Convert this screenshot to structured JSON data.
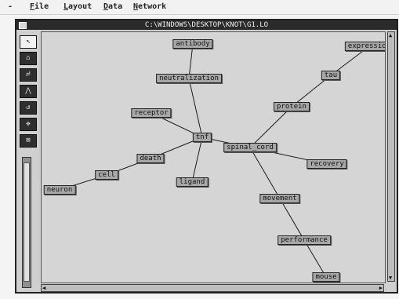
{
  "menubar": {
    "system_menu": "-",
    "items": [
      {
        "underline": "F",
        "rest": "ile"
      },
      {
        "underline": "L",
        "rest": "ayout"
      },
      {
        "underline": "D",
        "rest": "ata"
      },
      {
        "underline": "N",
        "rest": "etwork"
      }
    ]
  },
  "window": {
    "title": "C:\\WINDOWS\\DESKTOP\\KNOT\\G1.LO"
  },
  "toolbar": {
    "tools": [
      {
        "name": "select-tool",
        "glyph": "↖"
      },
      {
        "name": "node-tool",
        "glyph": "⌂"
      },
      {
        "name": "link-tool",
        "glyph": "≓"
      },
      {
        "name": "line-tool",
        "glyph": "⋀"
      },
      {
        "name": "rotate-tool",
        "glyph": "↺"
      },
      {
        "name": "move-tool",
        "glyph": "✥"
      },
      {
        "name": "layout-tool",
        "glyph": "⊠"
      }
    ]
  },
  "graph": {
    "nodes": [
      {
        "id": "antibody",
        "label": "antibody"
      },
      {
        "id": "neutralization",
        "label": "neutralization"
      },
      {
        "id": "receptor",
        "label": "receptor"
      },
      {
        "id": "tnf",
        "label": "tnf"
      },
      {
        "id": "death",
        "label": "death"
      },
      {
        "id": "cell",
        "label": "cell"
      },
      {
        "id": "neuron",
        "label": "neuron"
      },
      {
        "id": "ligand",
        "label": "ligand"
      },
      {
        "id": "spinal_cord",
        "label": "spinal_cord"
      },
      {
        "id": "expression",
        "label": "expression"
      },
      {
        "id": "tau",
        "label": "tau"
      },
      {
        "id": "protein",
        "label": "protein"
      },
      {
        "id": "recovery",
        "label": "recovery"
      },
      {
        "id": "movement",
        "label": "movement"
      },
      {
        "id": "performance",
        "label": "performance"
      },
      {
        "id": "mouse",
        "label": "mouse"
      }
    ],
    "edges": [
      [
        "antibody",
        "neutralization"
      ],
      [
        "neutralization",
        "tnf"
      ],
      [
        "receptor",
        "tnf"
      ],
      [
        "tnf",
        "death"
      ],
      [
        "death",
        "cell"
      ],
      [
        "cell",
        "neuron"
      ],
      [
        "tnf",
        "ligand"
      ],
      [
        "tnf",
        "spinal_cord"
      ],
      [
        "spinal_cord",
        "protein"
      ],
      [
        "protein",
        "tau"
      ],
      [
        "tau",
        "expression"
      ],
      [
        "spinal_cord",
        "recovery"
      ],
      [
        "spinal_cord",
        "movement"
      ],
      [
        "movement",
        "performance"
      ],
      [
        "performance",
        "mouse"
      ]
    ]
  }
}
